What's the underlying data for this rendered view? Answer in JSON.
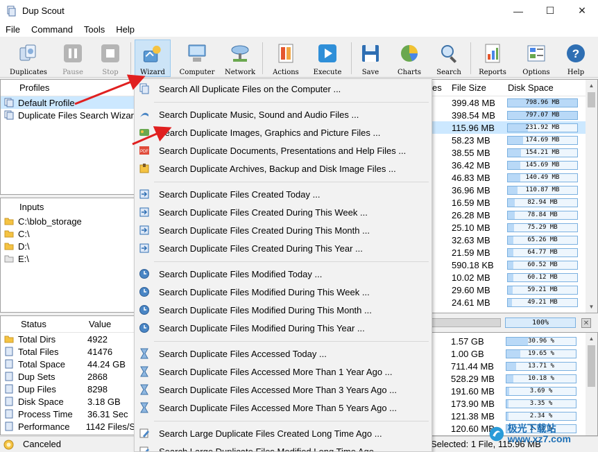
{
  "window": {
    "title": "Dup Scout",
    "controls": [
      "—",
      "☐",
      "✕"
    ]
  },
  "menu": [
    "File",
    "Command",
    "Tools",
    "Help"
  ],
  "toolbar": {
    "duplicates": "Duplicates",
    "pause": "Pause",
    "stop": "Stop",
    "wizard": "Wizard",
    "computer": "Computer",
    "network": "Network",
    "actions": "Actions",
    "execute": "Execute",
    "save": "Save",
    "charts": "Charts",
    "search": "Search",
    "reports": "Reports",
    "options": "Options",
    "help": "Help"
  },
  "profiles": {
    "header": "Profiles",
    "items": [
      "Default Profile",
      "Duplicate Files Search Wizard"
    ]
  },
  "inputs": {
    "header": "Inputs",
    "items": [
      "C:\\blob_storage",
      "C:\\",
      "D:\\",
      "E:\\"
    ]
  },
  "status_panel": {
    "headers": [
      "Status",
      "Value"
    ],
    "rows": [
      {
        "label": "Total Dirs",
        "value": "4922"
      },
      {
        "label": "Total Files",
        "value": "41476"
      },
      {
        "label": "Total Space",
        "value": "44.24 GB"
      },
      {
        "label": "Dup Sets",
        "value": "2868"
      },
      {
        "label": "Dup Files",
        "value": "8298"
      },
      {
        "label": "Disk Space",
        "value": "3.18 GB"
      },
      {
        "label": "Process Time",
        "value": "36.31 Sec"
      },
      {
        "label": "Performance",
        "value": "1142 Files/S"
      }
    ]
  },
  "results": {
    "headers": [
      "es",
      "File Size",
      "Disk Space"
    ],
    "rows": [
      {
        "size": "399.48 MB",
        "disk": "798.96 MB",
        "fill": 1.0
      },
      {
        "size": "398.54 MB",
        "disk": "797.07 MB",
        "fill": 0.998
      },
      {
        "size": "115.96 MB",
        "disk": "231.92 MB",
        "fill": 0.29
      },
      {
        "size": "58.23 MB",
        "disk": "174.69 MB",
        "fill": 0.219
      },
      {
        "size": "38.55 MB",
        "disk": "154.21 MB",
        "fill": 0.193
      },
      {
        "size": "36.42 MB",
        "disk": "145.69 MB",
        "fill": 0.182
      },
      {
        "size": "46.83 MB",
        "disk": "140.49 MB",
        "fill": 0.176
      },
      {
        "size": "36.96 MB",
        "disk": "110.87 MB",
        "fill": 0.139
      },
      {
        "size": "16.59 MB",
        "disk": "82.94 MB",
        "fill": 0.104
      },
      {
        "size": "26.28 MB",
        "disk": "78.84 MB",
        "fill": 0.099
      },
      {
        "size": "25.10 MB",
        "disk": "75.29 MB",
        "fill": 0.094
      },
      {
        "size": "32.63 MB",
        "disk": "65.26 MB",
        "fill": 0.082
      },
      {
        "size": "21.59 MB",
        "disk": "64.77 MB",
        "fill": 0.081
      },
      {
        "size": "590.18 KB",
        "disk": "60.52 MB",
        "fill": 0.076
      },
      {
        "size": "10.02 MB",
        "disk": "60.12 MB",
        "fill": 0.075
      },
      {
        "size": "29.60 MB",
        "disk": "59.21 MB",
        "fill": 0.074
      },
      {
        "size": "24.61 MB",
        "disk": "49.21 MB",
        "fill": 0.062
      }
    ]
  },
  "summary_bar": {
    "percent": "100%"
  },
  "stats": {
    "rows": [
      {
        "size": "1.57 GB",
        "pct": "30.96 %",
        "fill": 0.3096
      },
      {
        "size": "1.00 GB",
        "pct": "19.65 %",
        "fill": 0.1965
      },
      {
        "size": "711.44 MB",
        "pct": "13.71 %",
        "fill": 0.1371
      },
      {
        "size": "528.29 MB",
        "pct": "10.18 %",
        "fill": 0.1018
      },
      {
        "size": "191.60 MB",
        "pct": "3.69 %",
        "fill": 0.0369
      },
      {
        "size": "173.90 MB",
        "pct": "3.35 %",
        "fill": 0.0335
      },
      {
        "size": "121.38 MB",
        "pct": "2.34 %",
        "fill": 0.0234
      },
      {
        "size": "120.60 MB",
        "pct": "2.32 %",
        "fill": 0.0232
      }
    ]
  },
  "statusbar": {
    "state": "Canceled",
    "selection": "Selected: 1 File, 115.96 MB"
  },
  "wizard_menu": [
    {
      "label": "Search All Duplicate Files on the Computer ...",
      "icon": "copy-icon"
    },
    {
      "label": "Search Duplicate Music, Sound and Audio Files ...",
      "icon": "music-icon"
    },
    {
      "label": "Search Duplicate Images, Graphics and Picture Files ...",
      "icon": "image-icon"
    },
    {
      "label": "Search Duplicate Documents, Presentations and Help Files ...",
      "icon": "pdf-icon"
    },
    {
      "label": "Search Duplicate Archives, Backup and Disk Image Files ...",
      "icon": "archive-icon"
    },
    {
      "label": "Search Duplicate Files Created Today ...",
      "icon": "created-icon"
    },
    {
      "label": "Search Duplicate Files Created During This Week ...",
      "icon": "created-icon"
    },
    {
      "label": "Search Duplicate Files Created During This Month ...",
      "icon": "created-icon"
    },
    {
      "label": "Search Duplicate Files Created During This Year ...",
      "icon": "created-icon"
    },
    {
      "label": "Search Duplicate Files Modified Today ...",
      "icon": "clock-icon"
    },
    {
      "label": "Search Duplicate Files Modified During This Week ...",
      "icon": "clock-icon"
    },
    {
      "label": "Search Duplicate Files Modified During This Month ...",
      "icon": "clock-icon"
    },
    {
      "label": "Search Duplicate Files Modified During This Year ...",
      "icon": "clock-icon"
    },
    {
      "label": "Search Duplicate Files Accessed Today ...",
      "icon": "hourglass-icon"
    },
    {
      "label": "Search Duplicate Files Accessed More Than 1 Year Ago ...",
      "icon": "hourglass-icon"
    },
    {
      "label": "Search Duplicate Files Accessed More Than 3 Years Ago ...",
      "icon": "hourglass-icon"
    },
    {
      "label": "Search Duplicate Files Accessed More Than 5 Years Ago ...",
      "icon": "hourglass-icon"
    },
    {
      "label": "Search Large Duplicate Files Created Long Time Ago ...",
      "icon": "edit-icon"
    },
    {
      "label": "Search Large Duplicate Files Modified Long Time Ago ...",
      "icon": "edit-icon"
    }
  ],
  "watermark": "极光下载站 www.xz7.com",
  "colors": {
    "accent": "#0078d7",
    "bar_fill": "#b9d9f7",
    "bar_border": "#7ab0e0",
    "arrow": "#e02020"
  }
}
